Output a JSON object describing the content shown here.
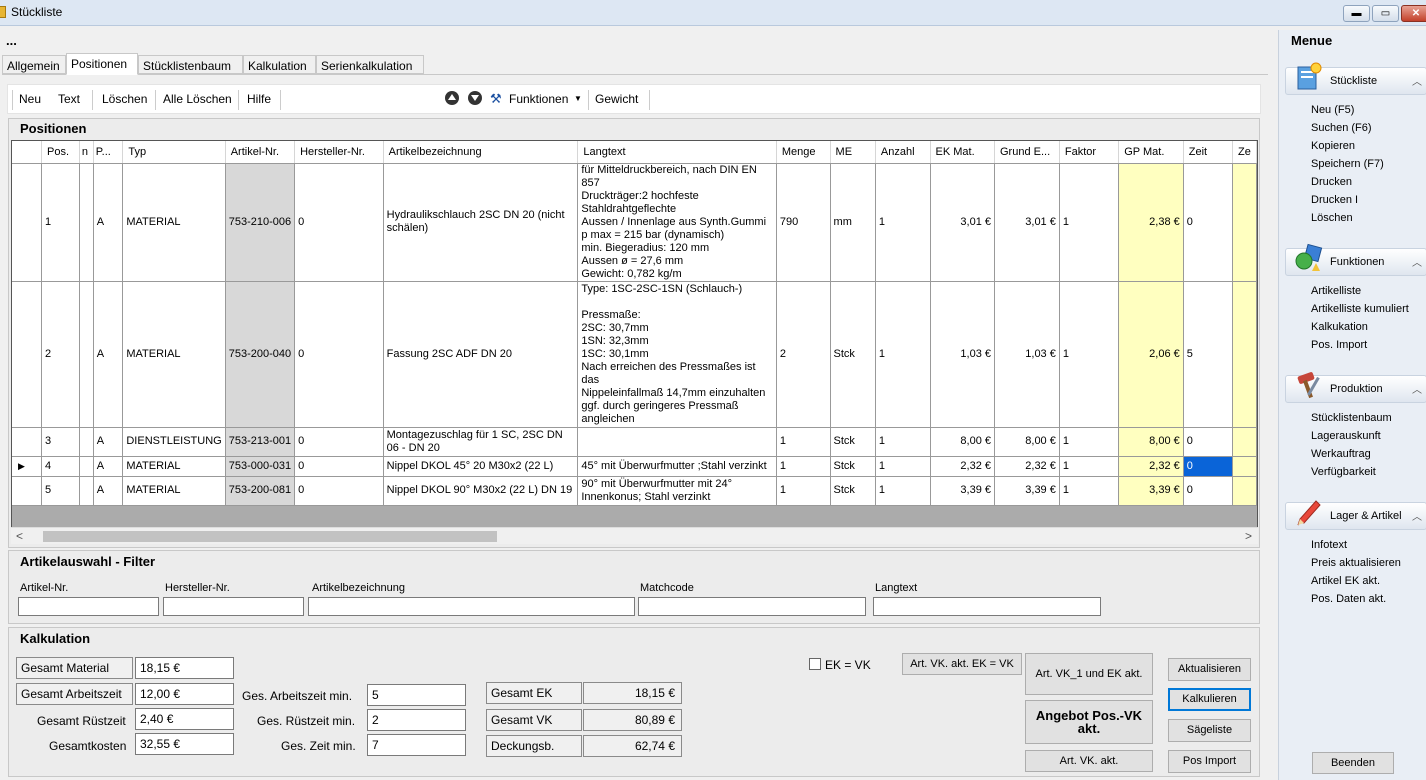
{
  "window": {
    "title": "Stückliste",
    "btn_min": "▬",
    "btn_max": "▭",
    "btn_close": "✕"
  },
  "dots": "...",
  "tabs": [
    "Allgemein",
    "Positionen",
    "Stücklistenbaum",
    "Kalkulation",
    "Serienkalkulation"
  ],
  "toolbar": {
    "neu": "Neu",
    "text": "Text",
    "loeschen": "Löschen",
    "alle_loeschen": "Alle Löschen",
    "hilfe": "Hilfe",
    "funktionen": "Funktionen",
    "gewicht": "Gewicht"
  },
  "positionen": {
    "title": "Positionen",
    "columns": [
      "Pos.",
      "n",
      "P...",
      "Typ",
      "Artikel-Nr.",
      "Hersteller-Nr.",
      "Artikelbezeichnung",
      "Langtext",
      "Menge",
      "ME",
      "Anzahl",
      "EK Mat.",
      "Grund E...",
      "Faktor",
      "GP Mat.",
      "Zeit",
      "Ze"
    ],
    "rows": [
      {
        "pos": "1",
        "n": "",
        "p": "A",
        "typ": "MATERIAL",
        "artnr": "753-210-006",
        "hernr": "0",
        "bez": "Hydraulikschlauch 2SC DN 20 (nicht schälen)",
        "lang": [
          "für Mitteldruckbereich, nach DIN EN 857",
          "Druckträger:2 hochfeste",
          "Stahldrahtgeflechte",
          "Aussen / Innenlage aus Synth.Gummi",
          "p max = 215 bar (dynamisch)",
          "min. Biegeradius: 120 mm",
          "Aussen ø = 27,6 mm",
          "Gewicht: 0,782 kg/m"
        ],
        "menge": "790",
        "me": "mm",
        "anzahl": "1",
        "ek": "3,01 €",
        "grund": "3,01 €",
        "faktor": "1",
        "gp": "2,38 €",
        "zeit": "0"
      },
      {
        "pos": "2",
        "n": "",
        "p": "A",
        "typ": "MATERIAL",
        "artnr": "753-200-040",
        "hernr": "0",
        "bez": "Fassung 2SC ADF DN 20",
        "lang": [
          "Type: 1SC-2SC-1SN (Schlauch-)",
          "",
          "Pressmaße:",
          "2SC: 30,7mm",
          "1SN: 32,3mm",
          "1SC: 30,1mm",
          "Nach erreichen des Pressmaßes ist das",
          "Nippeleinfallmaß 14,7mm einzuhalten",
          "ggf. durch geringeres Pressmaß",
          "angleichen"
        ],
        "menge": "2",
        "me": "Stck",
        "anzahl": "1",
        "ek": "1,03 €",
        "grund": "1,03 €",
        "faktor": "1",
        "gp": "2,06 €",
        "zeit": "5"
      },
      {
        "pos": "3",
        "n": "",
        "p": "A",
        "typ": "DIENSTLEISTUNG",
        "artnr": "753-213-001",
        "hernr": "0",
        "bez": "Montagezuschlag für 1 SC, 2SC DN 06 - DN 20",
        "lang": [],
        "menge": "1",
        "me": "Stck",
        "anzahl": "1",
        "ek": "8,00 €",
        "grund": "8,00 €",
        "faktor": "1",
        "gp": "8,00 €",
        "zeit": "0"
      },
      {
        "pos": "4",
        "n": "",
        "p": "A",
        "typ": "MATERIAL",
        "artnr": "753-000-031",
        "hernr": "0",
        "bez": "Nippel DKOL 45° 20 M30x2 (22 L)",
        "lang": [
          "45° mit Überwurfmutter ;Stahl verzinkt"
        ],
        "menge": "1",
        "me": "Stck",
        "anzahl": "1",
        "ek": "2,32 €",
        "grund": "2,32 €",
        "faktor": "1",
        "gp": "2,32 €",
        "zeit": "0"
      },
      {
        "pos": "5",
        "n": "",
        "p": "A",
        "typ": "MATERIAL",
        "artnr": "753-200-081",
        "hernr": "0",
        "bez": "Nippel DKOL 90° M30x2 (22 L) DN 19",
        "lang": [
          "90° mit Überwurfmutter mit 24°",
          "Innenkonus; Stahl verzinkt"
        ],
        "menge": "1",
        "me": "Stck",
        "anzahl": "1",
        "ek": "3,39 €",
        "grund": "3,39 €",
        "faktor": "1",
        "gp": "3,39 €",
        "zeit": "0"
      }
    ],
    "current_row_marker": "▶"
  },
  "filter": {
    "title": "Artikelauswahl - Filter",
    "labels": {
      "artnr": "Artikel-Nr.",
      "hernr": "Hersteller-Nr.",
      "bez": "Artikelbezeichnung",
      "match": "Matchcode",
      "lang": "Langtext"
    },
    "values": {
      "artnr": "",
      "hernr": "",
      "bez": "",
      "match": "",
      "lang": ""
    }
  },
  "kalkulation": {
    "title": "Kalkulation",
    "gesamt_material_label": "Gesamt Material",
    "gesamt_material": "18,15 €",
    "gesamt_arbeitszeit_label": "Gesamt Arbeitszeit",
    "gesamt_arbeitszeit": "12,00 €",
    "gesamt_ruestzeit_label": "Gesamt Rüstzeit",
    "gesamt_ruestzeit": "2,40 €",
    "gesamtkosten_label": "Gesamtkosten",
    "gesamtkosten": "32,55 €",
    "ges_arbeitszeit_min_label": "Ges. Arbeitszeit min.",
    "ges_arbeitszeit_min": "5",
    "ges_ruestzeit_min_label": "Ges. Rüstzeit min.",
    "ges_ruestzeit_min": "2",
    "ges_zeit_min_label": "Ges. Zeit min.",
    "ges_zeit_min": "7",
    "gesamt_ek_label": "Gesamt EK",
    "gesamt_ek": "18,15 €",
    "gesamt_vk_label": "Gesamt VK",
    "gesamt_vk": "80,89 €",
    "deckungsb_label": "Deckungsb.",
    "deckungsb": "62,74 €",
    "ek_vk_label": "EK = VK",
    "ek_vk_checked": false,
    "btn_art_vk_ek": "Art. VK. akt. EK = VK",
    "btn_art_vk1_ek": "Art. VK_1 und EK akt.",
    "btn_angebot": "Angebot Pos.-VK akt.",
    "btn_art_vk": "Art. VK. akt.",
    "btn_aktualisieren": "Aktualisieren",
    "btn_kalkulieren": "Kalkulieren",
    "btn_saegeliste": "Sägeliste",
    "btn_pos_import": "Pos Import"
  },
  "menu": {
    "title": "Menue",
    "groups": [
      {
        "label": "Stückliste",
        "icon": "document-star-icon",
        "items": [
          "Neu (F5)",
          "Suchen (F6)",
          "Kopieren",
          "Speichern (F7)",
          "Drucken",
          "Drucken I",
          "Löschen"
        ]
      },
      {
        "label": "Funktionen",
        "icon": "shapes-icon",
        "items": [
          "Artikelliste",
          "Artikelliste kumuliert",
          "Kalkukation",
          "Pos. Import"
        ]
      },
      {
        "label": "Produktion",
        "icon": "tools-icon",
        "items": [
          "Stücklistenbaum",
          "Lagerauskunft",
          "Werkauftrag",
          "Verfügbarkeit"
        ]
      },
      {
        "label": "Lager & Artikel",
        "icon": "pencil-icon",
        "items": [
          "Infotext",
          "Preis aktualisieren",
          "Artikel EK akt.",
          "Pos. Daten akt."
        ]
      }
    ],
    "beenden": "Beenden"
  }
}
